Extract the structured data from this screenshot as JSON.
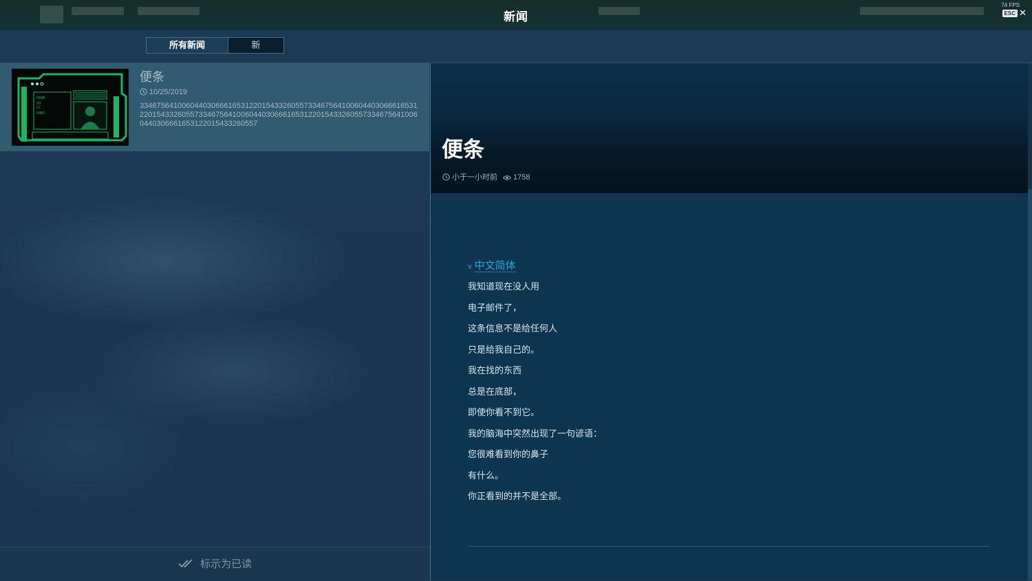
{
  "header": {
    "title": "新闻",
    "fps": "74 FPS",
    "esc_label": "ESC",
    "close_glyph": "✕"
  },
  "tabs": [
    {
      "label": "所有新闻",
      "active": true
    },
    {
      "label": "新",
      "active": false
    }
  ],
  "news_list": {
    "items": [
      {
        "title": "便条",
        "date": "10/25/2019",
        "preview": "3346756410060440306661653122015433260557334675641006044030666165312201543326055733467564100604403066616531220154332605573346756410060440306661653122015433260557"
      }
    ],
    "mark_read_label": "标示为已读"
  },
  "article": {
    "title": "便条",
    "time_ago": "小于一小时前",
    "views": "1758",
    "language_label": "中文简体",
    "lines": [
      "我知道现在没人用",
      "电子邮件了，",
      "这条信息不是给任何人",
      "只是给我自己的。",
      "我在找的东西",
      "总是在底部，",
      "即使你看不到它。",
      "我的脑海中突然出现了一句谚语：",
      "您很难看到你的鼻子",
      "有什么。",
      "你正看到的并不是全部。"
    ]
  },
  "colors": {
    "accent": "#29a5d6",
    "thumb_frame": "#1fb36a"
  }
}
